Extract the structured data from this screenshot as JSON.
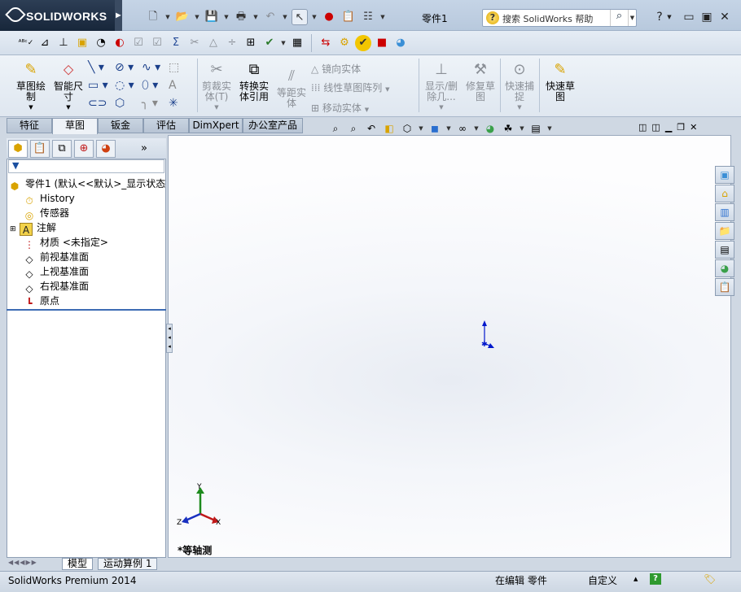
{
  "title": {
    "brand": "SOLIDWORKS",
    "document": "零件1"
  },
  "search": {
    "placeholder": "搜索 SolidWorks 帮助"
  },
  "ribbon": {
    "sketch": "草图绘\n制",
    "smart_dimension": "智能尺\n寸",
    "trim": "剪裁实\n体(T)",
    "convert": "转换实\n体引用",
    "offset": "等距实\n体",
    "mirror": "镜向实体",
    "linear_pattern": "线性草图阵列",
    "move": "移动实体",
    "show_delete": "显示/删\n除几...",
    "repair": "修复草\n图",
    "quick_snap": "快速捕\n捉",
    "rapid_sketch": "快速草\n图"
  },
  "tabs": [
    "特征",
    "草图",
    "钣金",
    "评估",
    "DimXpert",
    "办公室产品"
  ],
  "active_tab": "草图",
  "tree": {
    "root": "零件1  (默认<<默认>_显示状态",
    "items": [
      {
        "label": "History",
        "icon": "history-icon"
      },
      {
        "label": "传感器",
        "icon": "sensor-icon"
      },
      {
        "label": "注解",
        "icon": "annotation-icon"
      },
      {
        "label": "材质 <未指定>",
        "icon": "material-icon"
      },
      {
        "label": "前视基准面",
        "icon": "plane-icon"
      },
      {
        "label": "上视基准面",
        "icon": "plane-icon"
      },
      {
        "label": "右视基准面",
        "icon": "plane-icon"
      },
      {
        "label": "原点",
        "icon": "origin-icon"
      }
    ]
  },
  "viewport": {
    "view_label": "*等轴测"
  },
  "triad": {
    "x": "X",
    "y": "Y",
    "z": "Z"
  },
  "bottom_tabs": [
    "模型",
    "运动算例 1"
  ],
  "status": {
    "product": "SolidWorks Premium 2014",
    "mode": "在编辑 零件",
    "units": "自定义"
  },
  "colors": {
    "accent": "#3d6cb4",
    "brand_bg": "#1f2f45"
  }
}
